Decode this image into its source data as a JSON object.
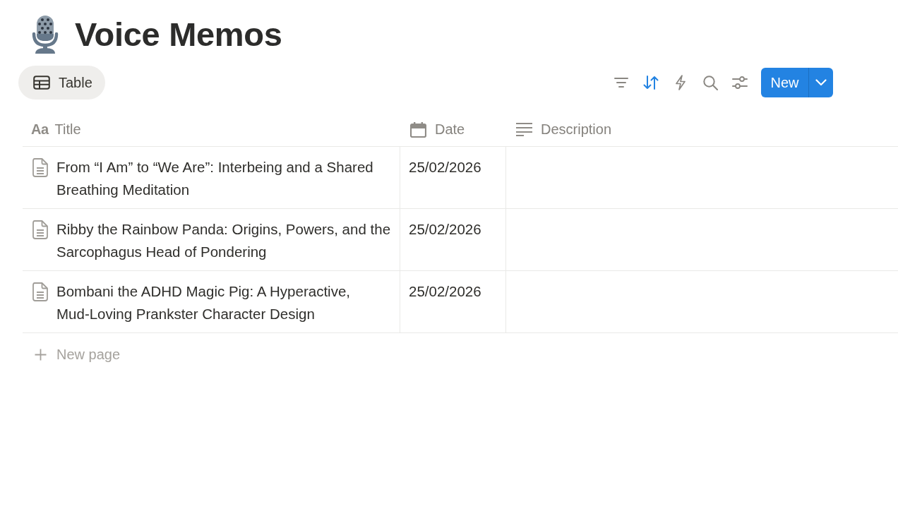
{
  "page": {
    "title": "Voice Memos"
  },
  "views": [
    {
      "label": "Table",
      "selected": true
    }
  ],
  "toolbar": {
    "actions": [
      {
        "kind": "filter",
        "active": false
      },
      {
        "kind": "sort",
        "active": true
      },
      {
        "kind": "automation",
        "active": false
      },
      {
        "kind": "search",
        "active": false
      },
      {
        "kind": "settings",
        "active": false
      }
    ],
    "new_button": {
      "label": "New"
    }
  },
  "table": {
    "columns": [
      {
        "label": "Title",
        "kind": "title",
        "glyph": "Aa"
      },
      {
        "label": "Date",
        "kind": "date"
      },
      {
        "label": "Description",
        "kind": "text"
      }
    ],
    "rows": [
      {
        "title": "From “I Am” to “We Are”: Interbeing and a Shared Breathing Meditation",
        "date": "25/02/2026"
      },
      {
        "title": "Ribby the Rainbow Panda: Origins, Powers, and the Sarcophagus Head of Pondering",
        "date": "25/02/2026"
      },
      {
        "title": "Bombani the ADHD Magic Pig: A Hyperactive, Mud-Loving Prankster Character Design",
        "date": "25/02/2026"
      }
    ],
    "new_row": {
      "label": "New page"
    }
  }
}
